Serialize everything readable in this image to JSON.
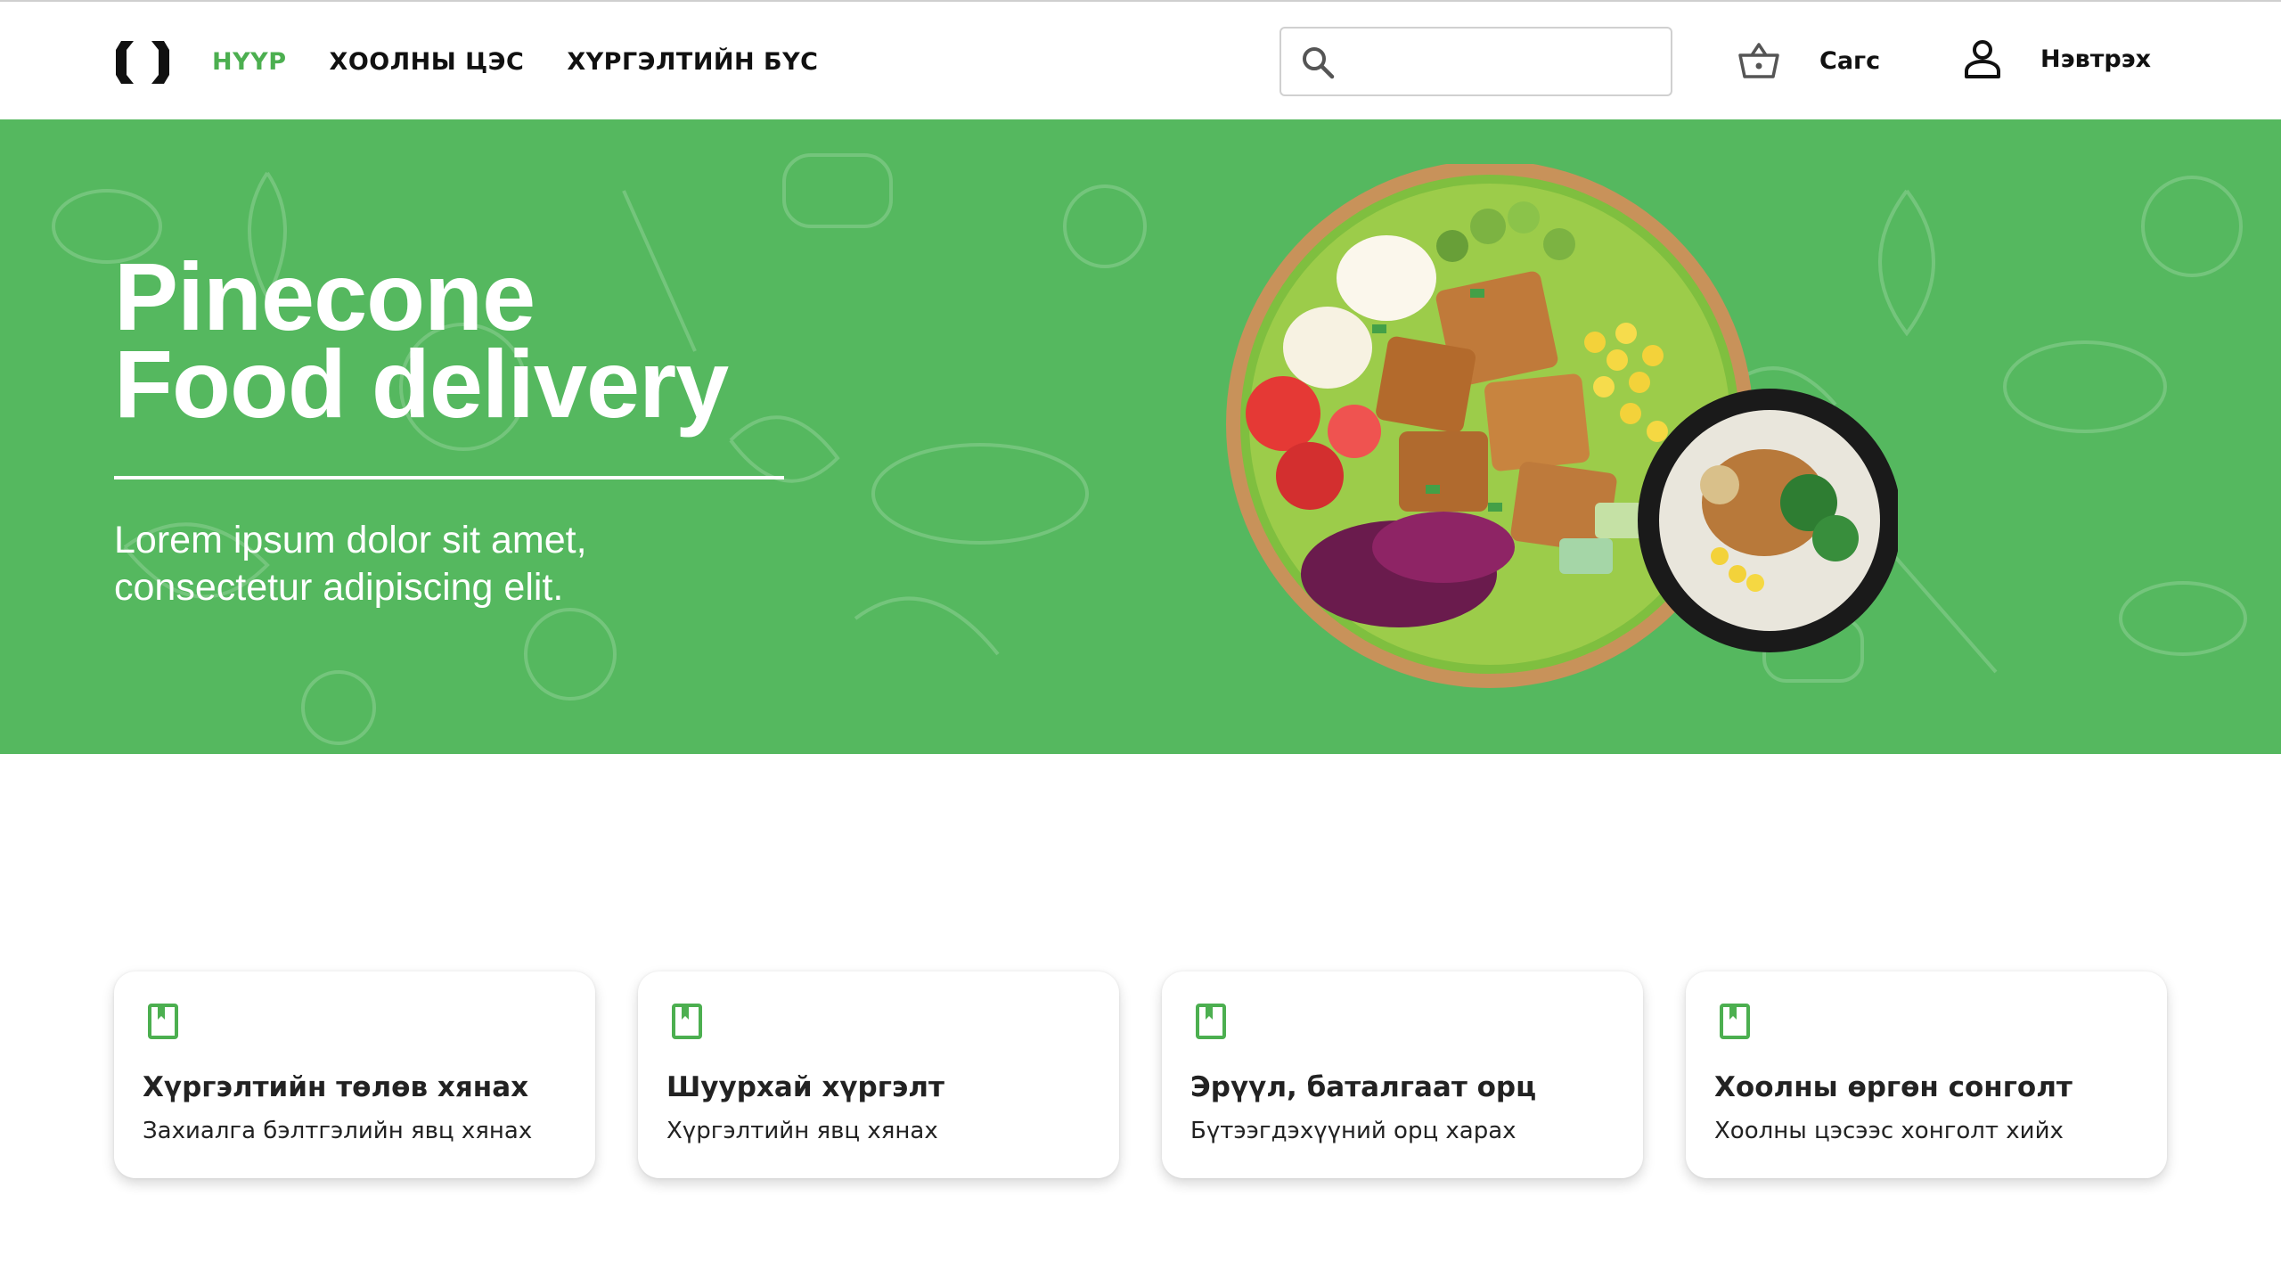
{
  "header": {
    "logo_icon": "brackets-logo-icon",
    "nav": [
      {
        "label": "НҮҮР",
        "active": true
      },
      {
        "label": "ХООЛНЫ ЦЭС",
        "active": false
      },
      {
        "label": "ХҮРГЭЛТИЙН БҮС",
        "active": false
      }
    ],
    "search": {
      "placeholder": "",
      "value": "",
      "icon": "search-icon"
    },
    "cart": {
      "label": "Сагс",
      "icon": "basket-icon"
    },
    "login": {
      "label": "Нэвтрэх",
      "icon": "user-icon"
    }
  },
  "hero": {
    "title_line1": "Pinecone",
    "title_line2": "Food delivery",
    "subtitle_line1": "Lorem ipsum dolor sit amet,",
    "subtitle_line2": "consectetur adipiscing elit.",
    "background_color": "#55b85f"
  },
  "features": [
    {
      "icon": "book-icon",
      "title": "Хүргэлтийн төлөв хянах",
      "description": "Захиалга бэлтгэлийн явц хянах"
    },
    {
      "icon": "book-icon",
      "title": "Шуурхай хүргэлт",
      "description": "Хүргэлтийн явц хянах"
    },
    {
      "icon": "book-icon",
      "title": "Эрүүл, баталгаат орц",
      "description": "Бүтээгдэхүүний орц харах"
    },
    {
      "icon": "book-icon",
      "title": "Хоолны өргөн сонголт",
      "description": "Хоолны цэсээс хонголт хийх"
    }
  ],
  "colors": {
    "accent": "#4caf50",
    "hero": "#55b85f",
    "text": "#111111"
  }
}
